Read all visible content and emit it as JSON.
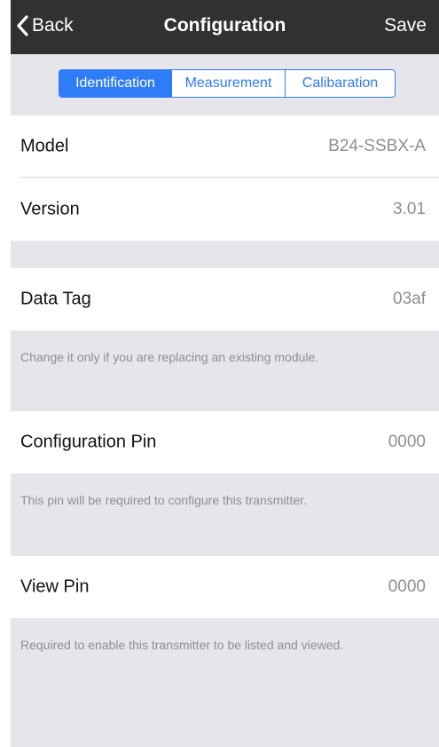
{
  "navbar": {
    "back_label": "Back",
    "title": "Configuration",
    "save_label": "Save"
  },
  "tabs": [
    {
      "label": "Identification",
      "selected": true
    },
    {
      "label": "Measurement",
      "selected": false
    },
    {
      "label": "Calibaration",
      "selected": false
    }
  ],
  "rows": {
    "model": {
      "label": "Model",
      "value": "B24-SSBX-A"
    },
    "version": {
      "label": "Version",
      "value": "3.01"
    },
    "data_tag": {
      "label": "Data Tag",
      "value": "03af",
      "footer": "Change it only if you are replacing an existing module."
    },
    "config_pin": {
      "label": "Configuration Pin",
      "value": "0000",
      "footer": "This pin will be required to configure this transmitter."
    },
    "view_pin": {
      "label": "View Pin",
      "value": "0000",
      "footer": "Required to enable this transmitter to be listed and viewed."
    }
  },
  "colors": {
    "navbar": "#313131",
    "accent": "#2e7cf6",
    "section_gray": "#e6e6ea",
    "secondary_text": "#8e8e93"
  },
  "icons": {
    "back": "chevron-left-icon"
  }
}
